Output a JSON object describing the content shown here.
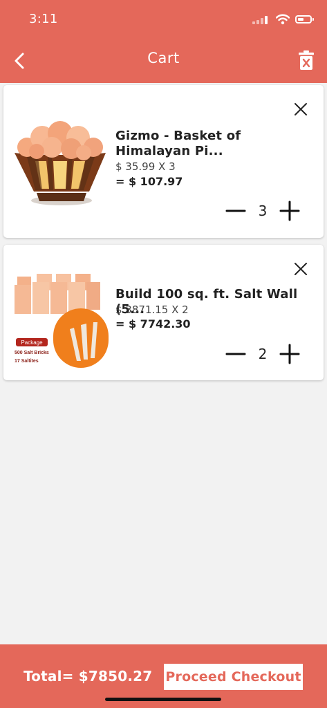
{
  "status_bar": {
    "time": "3:11"
  },
  "header": {
    "title": "Cart"
  },
  "cart_items": [
    {
      "name": "Gizmo - Basket of Himalayan Pi...",
      "unit_line": "$ 35.99 X 3",
      "line_total": "=  $ 107.97",
      "quantity": "3"
    },
    {
      "name": "Build 100 sq. ft. Salt Wall (5...",
      "unit_line": "$ 3871.15 X 2",
      "line_total": "=  $ 7742.30",
      "quantity": "2"
    }
  ],
  "package_image": {
    "badge": "Package",
    "line1": "500 Salt Bricks",
    "line2": "17 Saltites"
  },
  "footer": {
    "total": "Total= $7850.27",
    "checkout_label": "Proceed Checkout"
  },
  "colors": {
    "brand": "#e4685a"
  }
}
